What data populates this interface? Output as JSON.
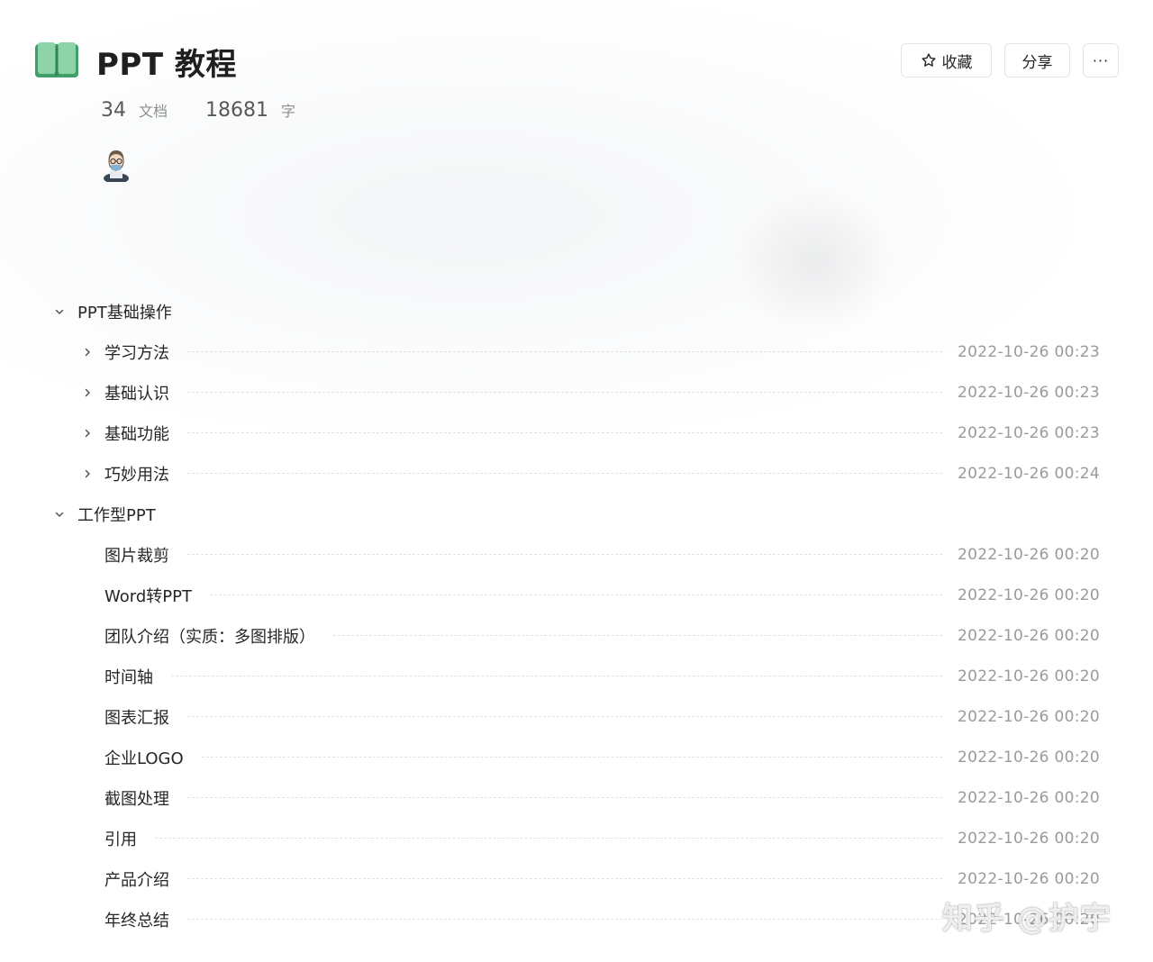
{
  "book": {
    "title": "PPT 教程",
    "icon": "book-open-icon",
    "accent": "#4CAF7A"
  },
  "actions": {
    "favorite_label": "收藏",
    "share_label": "分享",
    "more_label": "···"
  },
  "stats": {
    "doc_count": "34",
    "doc_unit": "文档",
    "word_count": "18681",
    "word_unit": "字"
  },
  "tree": {
    "groups": [
      {
        "label": "PPT基础操作",
        "expanded": true,
        "items": [
          {
            "label": "学习方法",
            "time": "2022-10-26 00:23",
            "has_children": true
          },
          {
            "label": "基础认识",
            "time": "2022-10-26 00:23",
            "has_children": true
          },
          {
            "label": "基础功能",
            "time": "2022-10-26 00:23",
            "has_children": true
          },
          {
            "label": "巧妙用法",
            "time": "2022-10-26 00:24",
            "has_children": true
          }
        ]
      },
      {
        "label": "工作型PPT",
        "expanded": true,
        "items": [
          {
            "label": "图片裁剪",
            "time": "2022-10-26 00:20",
            "has_children": false
          },
          {
            "label": "Word转PPT",
            "time": "2022-10-26 00:20",
            "has_children": false
          },
          {
            "label": "团队介绍（实质：多图排版）",
            "time": "2022-10-26 00:20",
            "has_children": false
          },
          {
            "label": "时间轴",
            "time": "2022-10-26 00:20",
            "has_children": false
          },
          {
            "label": "图表汇报",
            "time": "2022-10-26 00:20",
            "has_children": false
          },
          {
            "label": "企业LOGO",
            "time": "2022-10-26 00:20",
            "has_children": false
          },
          {
            "label": "截图处理",
            "time": "2022-10-26 00:20",
            "has_children": false
          },
          {
            "label": "引用",
            "time": "2022-10-26 00:20",
            "has_children": false
          },
          {
            "label": "产品介绍",
            "time": "2022-10-26 00:20",
            "has_children": false
          },
          {
            "label": "年终总结",
            "time": "2022-10-26 00:20",
            "has_children": false
          }
        ]
      }
    ]
  },
  "watermark": "知乎 @护宇"
}
